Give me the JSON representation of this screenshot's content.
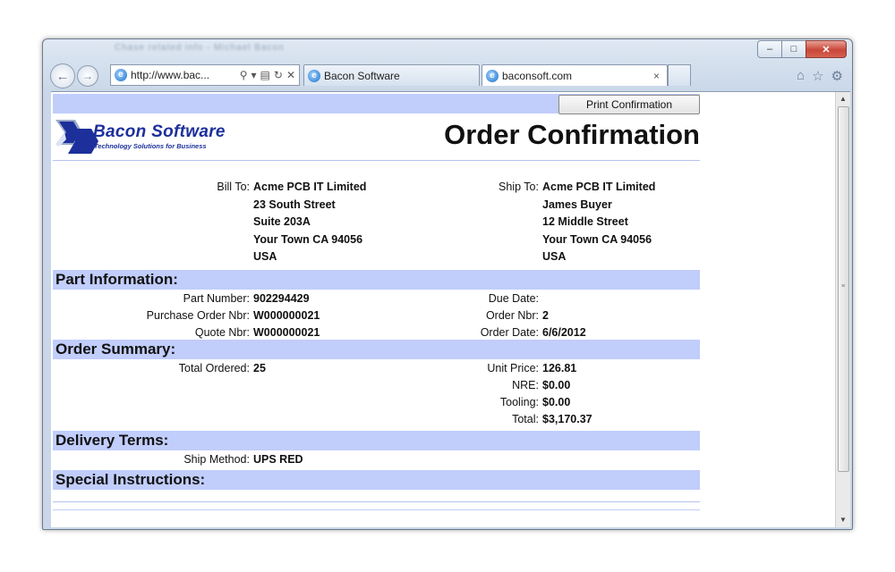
{
  "window": {
    "title_blurred": "Chase related info - Michael Bacon",
    "controls": {
      "minimize": "–",
      "maximize": "□",
      "close": "✕"
    }
  },
  "browser": {
    "address": "http://www.bac...",
    "address_icons": [
      "search-icon",
      "dropdown-icon",
      "compat-icon",
      "refresh-icon",
      "stop-icon"
    ],
    "tabs": [
      {
        "label": "Bacon Software",
        "active": false
      },
      {
        "label": "baconsoft.com",
        "active": true,
        "close": "×"
      }
    ],
    "right_icons": [
      "home-icon",
      "favorites-icon",
      "tools-icon"
    ]
  },
  "page": {
    "print_button": "Print Confirmation",
    "logo": {
      "name": "Bacon Software",
      "tagline": "Technology Solutions for Business"
    },
    "title": "Order Confirmation",
    "bill_to": {
      "label": "Bill To:",
      "lines": [
        "Acme PCB IT Limited",
        "23 South Street",
        "Suite 203A",
        "Your Town CA 94056",
        "USA"
      ]
    },
    "ship_to": {
      "label": "Ship To:",
      "lines": [
        "Acme PCB IT Limited",
        "James Buyer",
        "12 Middle Street",
        "Your Town CA 94056",
        "USA"
      ]
    },
    "part_information": {
      "heading": "Part Information:",
      "left": [
        {
          "label": "Part Number:",
          "value": "902294429"
        },
        {
          "label": "Purchase Order Nbr:",
          "value": "W000000021"
        },
        {
          "label": "Quote Nbr:",
          "value": "W000000021"
        }
      ],
      "right": [
        {
          "label": "Due Date:",
          "value": ""
        },
        {
          "label": "Order Nbr:",
          "value": "2"
        },
        {
          "label": "Order Date:",
          "value": "6/6/2012"
        }
      ]
    },
    "order_summary": {
      "heading": "Order Summary:",
      "left": [
        {
          "label": "Total Ordered:",
          "value": "25"
        }
      ],
      "right": [
        {
          "label": "Unit Price:",
          "value": "126.81"
        },
        {
          "label": "NRE:",
          "value": "$0.00"
        },
        {
          "label": "Tooling:",
          "value": "$0.00"
        },
        {
          "label": "Total:",
          "value": "$3,170.37"
        }
      ]
    },
    "delivery_terms": {
      "heading": "Delivery Terms:",
      "left": [
        {
          "label": "Ship Method:",
          "value": "UPS RED"
        }
      ]
    },
    "special_instructions": {
      "heading": "Special Instructions:"
    }
  },
  "colors": {
    "band": "#c1cdfb",
    "logo_blue": "#1c2f9b",
    "close_red": "#c9473a"
  }
}
